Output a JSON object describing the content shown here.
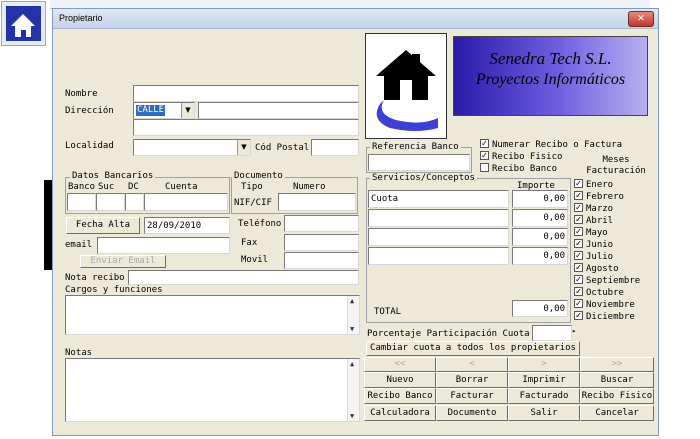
{
  "window": {
    "title": "Propietario",
    "close_glyph": "✕"
  },
  "form": {
    "nombre_label": "Nombre",
    "direccion_label": "Dirección",
    "direccion_tipo": "CALLE",
    "localidad_label": "Localidad",
    "cod_postal_label": "Cód Postal",
    "datos_bancarios_label": "Datos Bancarios",
    "banco_label": "Banco",
    "suc_label": "Suc",
    "dc_label": "DC",
    "cuenta_label": "Cuenta",
    "documento_label": "Documento",
    "tipo_label": "Tipo",
    "numero_label": "Numero",
    "nif_label": "NIF/CIF",
    "fecha_alta_button": "Fecha Alta",
    "fecha_alta_value": "28/09/2010",
    "telefono_label": "Teléfono",
    "fax_label": "Fax",
    "movil_label": "Movil",
    "email_label": "email",
    "enviar_email_button": "Enviar Email",
    "nota_recibo_label": "Nota recibo",
    "cargos_label": "Cargos y funciones",
    "notas_label": "Notas",
    "referencia_banco_label": "Referencia Banco",
    "numerar_recibo_label": "Numerar Recibo o Factura",
    "recibo_fisico_label": "Recibo Fisico",
    "recibo_banco_label": "Recibo Banco",
    "meses_facturacion_label": "Meses\nFacturación",
    "servicios_label": "Servicios/Conceptos",
    "importe_label": "Importe",
    "conceptos": [
      {
        "name": "Cuota",
        "importe": "0,00"
      },
      {
        "name": "",
        "importe": "0,00"
      },
      {
        "name": "",
        "importe": "0,00"
      },
      {
        "name": "",
        "importe": "0,00"
      }
    ],
    "total_label": "TOTAL",
    "total_value": "0,00",
    "porcentaje_label": "Porcentaje Participación Cuota",
    "cambiar_cuota_button": "Cambiar cuota a todos los propietarios"
  },
  "logo": {
    "company": "Senedra Tech S.L.",
    "tagline": "Proyectos Informáticos"
  },
  "months": [
    "Enero",
    "Febrero",
    "Marzo",
    "Abril",
    "Mayo",
    "Junio",
    "Julio",
    "Agosto",
    "Septiembre",
    "Octubre",
    "Noviembre",
    "Diciembre"
  ],
  "nav": {
    "first": "<<",
    "prev": "<",
    "next": ">",
    "last": ">>"
  },
  "buttons": {
    "nuevo": "Nuevo",
    "borrar": "Borrar",
    "imprimir": "Imprimir",
    "buscar": "Buscar",
    "recibo_banco": "Recibo Banco",
    "facturar": "Facturar",
    "facturado": "Facturado",
    "recibo_fisico": "Recibo Fisico",
    "calculadora": "Calculadora",
    "documento": "Documento",
    "salir": "Salir",
    "cancelar": "Cancelar"
  },
  "colors": {
    "window_bg": "#ece9d8",
    "titlebar": "#c9d9ee",
    "logo_bg": "#3f2fbf",
    "close": "#c0392b",
    "highlight": "#316ac5"
  }
}
